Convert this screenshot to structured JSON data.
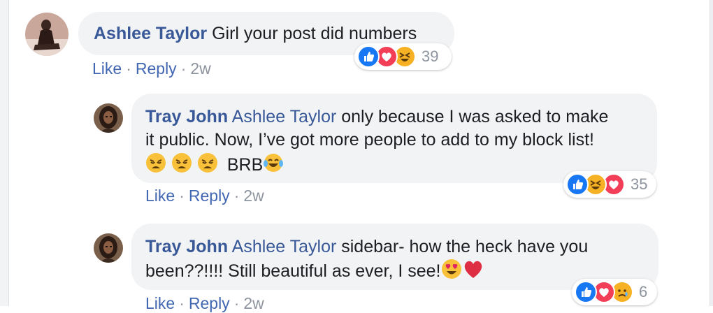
{
  "comments": [
    {
      "author": "Ashlee Taylor",
      "text": "Girl your post did numbers",
      "actions": {
        "like": "Like",
        "reply": "Reply",
        "time": "2w"
      },
      "reactions": {
        "icons": [
          "like",
          "love",
          "haha"
        ],
        "count": "39"
      }
    },
    {
      "author": "Tray John",
      "mention": "Ashlee Taylor",
      "text_line1": "only because I was asked to make",
      "text_line2": "it public. Now, I’ve got more people to add to my block list!",
      "text_line3": "BRB",
      "actions": {
        "like": "Like",
        "reply": "Reply",
        "time": "2w"
      },
      "reactions": {
        "icons": [
          "like",
          "haha",
          "love"
        ],
        "count": "35"
      }
    },
    {
      "author": "Tray John",
      "mention": "Ashlee Taylor",
      "text_line1": "sidebar- how the heck have you",
      "text_line2": "been??!!!! Still beautiful as ever, I see!",
      "actions": {
        "like": "Like",
        "reply": "Reply",
        "time": "2w"
      },
      "reactions": {
        "icons": [
          "like",
          "love",
          "sad"
        ],
        "count": "6"
      }
    }
  ],
  "colors": {
    "author": "#385898",
    "link": "#4267b2",
    "muted": "#8d949e",
    "bubble": "#f2f3f5",
    "like": "#1877f2",
    "love": "#f33e58",
    "haha": "#f7b125"
  }
}
